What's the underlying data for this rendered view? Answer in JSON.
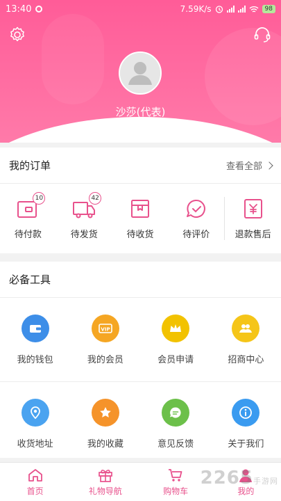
{
  "status_bar": {
    "time": "13:40",
    "network_speed": "7.59K/s",
    "battery": "98"
  },
  "profile": {
    "username": "沙莎(代表)"
  },
  "orders": {
    "title": "我的订单",
    "view_all": "查看全部",
    "items": [
      {
        "label": "待付款",
        "icon": "wallet-card-icon",
        "badge": "10"
      },
      {
        "label": "待发货",
        "icon": "truck-icon",
        "badge": "42"
      },
      {
        "label": "待收货",
        "icon": "box-icon",
        "badge": ""
      },
      {
        "label": "待评价",
        "icon": "comment-check-icon",
        "badge": ""
      },
      {
        "label": "退款售后",
        "icon": "refund-icon",
        "badge": ""
      }
    ]
  },
  "tools": {
    "title": "必备工具",
    "items": [
      {
        "label": "我的钱包",
        "icon": "wallet-icon",
        "color": "#3d8ee8"
      },
      {
        "label": "我的会员",
        "icon": "vip-icon",
        "color": "#f5a623"
      },
      {
        "label": "会员申请",
        "icon": "crown-icon",
        "color": "#f2c200"
      },
      {
        "label": "招商中心",
        "icon": "people-icon",
        "color": "#f5c518"
      },
      {
        "label": "收货地址",
        "icon": "location-icon",
        "color": "#4aa3f0"
      },
      {
        "label": "我的收藏",
        "icon": "star-icon",
        "color": "#f5932a"
      },
      {
        "label": "意见反馈",
        "icon": "feedback-icon",
        "color": "#6cc04a"
      },
      {
        "label": "关于我们",
        "icon": "info-icon",
        "color": "#3a9bf0"
      }
    ]
  },
  "tabbar": {
    "items": [
      {
        "label": "首页",
        "icon": "home-icon"
      },
      {
        "label": "礼物导航",
        "icon": "gift-icon"
      },
      {
        "label": "购物车",
        "icon": "cart-icon"
      },
      {
        "label": "我的",
        "icon": "user-icon"
      }
    ]
  },
  "watermark": {
    "main": "2265",
    "sub": "手游网"
  },
  "colors": {
    "accent": "#ff5c98",
    "icon_pink": "#e8518c"
  }
}
